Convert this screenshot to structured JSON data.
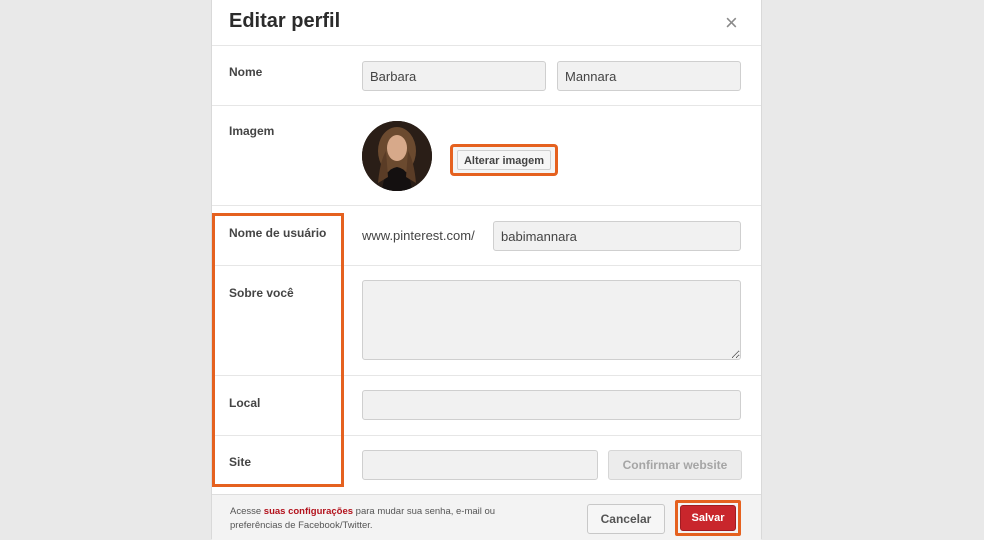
{
  "dialog": {
    "title": "Editar perfil",
    "close_symbol": "×"
  },
  "name_row": {
    "label": "Nome",
    "first_name": "Barbara",
    "last_name": "Mannara"
  },
  "image_row": {
    "label": "Imagem",
    "change_button": "Alterar imagem"
  },
  "username_row": {
    "label": "Nome de usuário",
    "prefix": "www.pinterest.com/",
    "username": "babimannara"
  },
  "about_row": {
    "label": "Sobre você",
    "value": ""
  },
  "location_row": {
    "label": "Local",
    "value": ""
  },
  "site_row": {
    "label": "Site",
    "value": "",
    "confirm_button": "Confirmar website"
  },
  "footer": {
    "text_before": "Acesse ",
    "link_text": "suas configurações",
    "text_after": " para mudar sua senha, e-mail ou preferências de Facebook/Twitter.",
    "cancel_label": "Cancelar",
    "save_label": "Salvar"
  },
  "colors": {
    "highlight": "#e5611f",
    "save_button": "#c9262c",
    "link": "#b3121c"
  }
}
